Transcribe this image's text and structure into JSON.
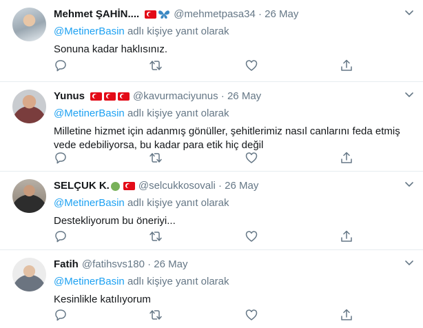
{
  "reply_prefix_suffix": "adlı kişiye yanıt olarak",
  "tweets": [
    {
      "name": "Mehmet ŞAHİN....",
      "handle": "@mehmetpasa34",
      "date": "26 May",
      "mention": "@MetinerBasin",
      "text": "Sonuna kadar haklısınız."
    },
    {
      "name": "Yunus",
      "handle": "@kavurmaciyunus",
      "date": "26 May",
      "mention": "@MetinerBasin",
      "text": "Milletine hizmet için adanmış gönüller, şehitlerimiz nasıl canlarını feda etmiş vede edebiliyorsa, bu kadar para etik hiç değil"
    },
    {
      "name": "SELÇUK K.",
      "handle": "@selcukkosovali",
      "date": "26 May",
      "mention": "@MetinerBasin",
      "text": "Destekliyorum bu öneriyi..."
    },
    {
      "name": "Fatih",
      "handle": "@fatihsvs180",
      "date": "26 May",
      "mention": "@MetinerBasin",
      "text": "Kesinlikle katılıyorum"
    }
  ],
  "colors": {
    "accent": "#1da1f2",
    "muted": "#657786",
    "text": "#14171a",
    "divider": "#e6ecf0"
  },
  "icons": [
    "reply-icon",
    "retweet-icon",
    "like-icon",
    "share-icon",
    "caret-down-icon",
    "turkey-flag-icon",
    "butterfly-icon",
    "green-circle-icon"
  ]
}
